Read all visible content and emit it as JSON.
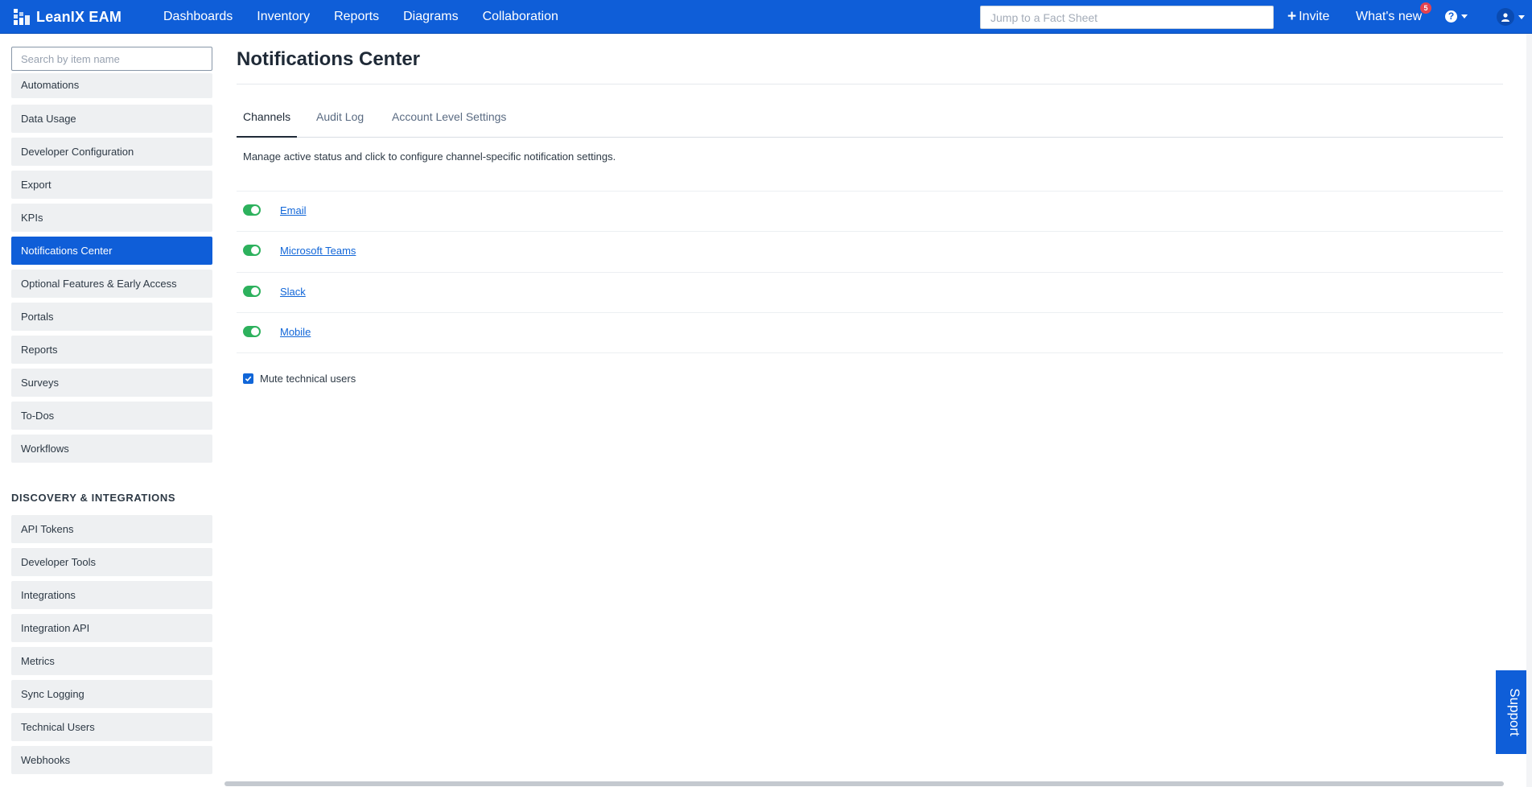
{
  "topbar": {
    "logo_text": "LeanIX EAM",
    "nav": [
      "Dashboards",
      "Inventory",
      "Reports",
      "Diagrams",
      "Collaboration"
    ],
    "jump_placeholder": "Jump to a Fact Sheet",
    "invite_label": "Invite",
    "whats_new_label": "What's new",
    "whats_new_count": "5",
    "help_symbol": "?",
    "icons": {
      "help": "question-circle-icon",
      "user": "user-avatar-icon",
      "caret": "caret-down-icon"
    }
  },
  "sidebar": {
    "search_placeholder": "Search by item name",
    "items": [
      "Automations",
      "Data Usage",
      "Developer Configuration",
      "Export",
      "KPIs",
      "Notifications Center",
      "Optional Features & Early Access",
      "Portals",
      "Reports",
      "Surveys",
      "To-Dos",
      "Workflows"
    ],
    "active_item": "Notifications Center",
    "section_heading": "DISCOVERY & INTEGRATIONS",
    "section_items": [
      "API Tokens",
      "Developer Tools",
      "Integrations",
      "Integration API",
      "Metrics",
      "Sync Logging",
      "Technical Users",
      "Webhooks"
    ]
  },
  "main": {
    "title": "Notifications Center",
    "tabs": [
      "Channels",
      "Audit Log",
      "Account Level Settings"
    ],
    "active_tab": "Channels",
    "description": "Manage active status and click to configure channel-specific notification settings.",
    "channels": [
      {
        "label": "Email",
        "enabled": true
      },
      {
        "label": "Microsoft Teams",
        "enabled": true
      },
      {
        "label": "Slack",
        "enabled": true
      },
      {
        "label": "Mobile",
        "enabled": true
      }
    ],
    "mute_label": "Mute technical users",
    "mute_checked": true
  },
  "support_label": "Support",
  "colors": {
    "brand": "#0f5ed8",
    "toggle_on": "#2db15d",
    "link": "#1166d8",
    "badge": "#e6434f"
  }
}
